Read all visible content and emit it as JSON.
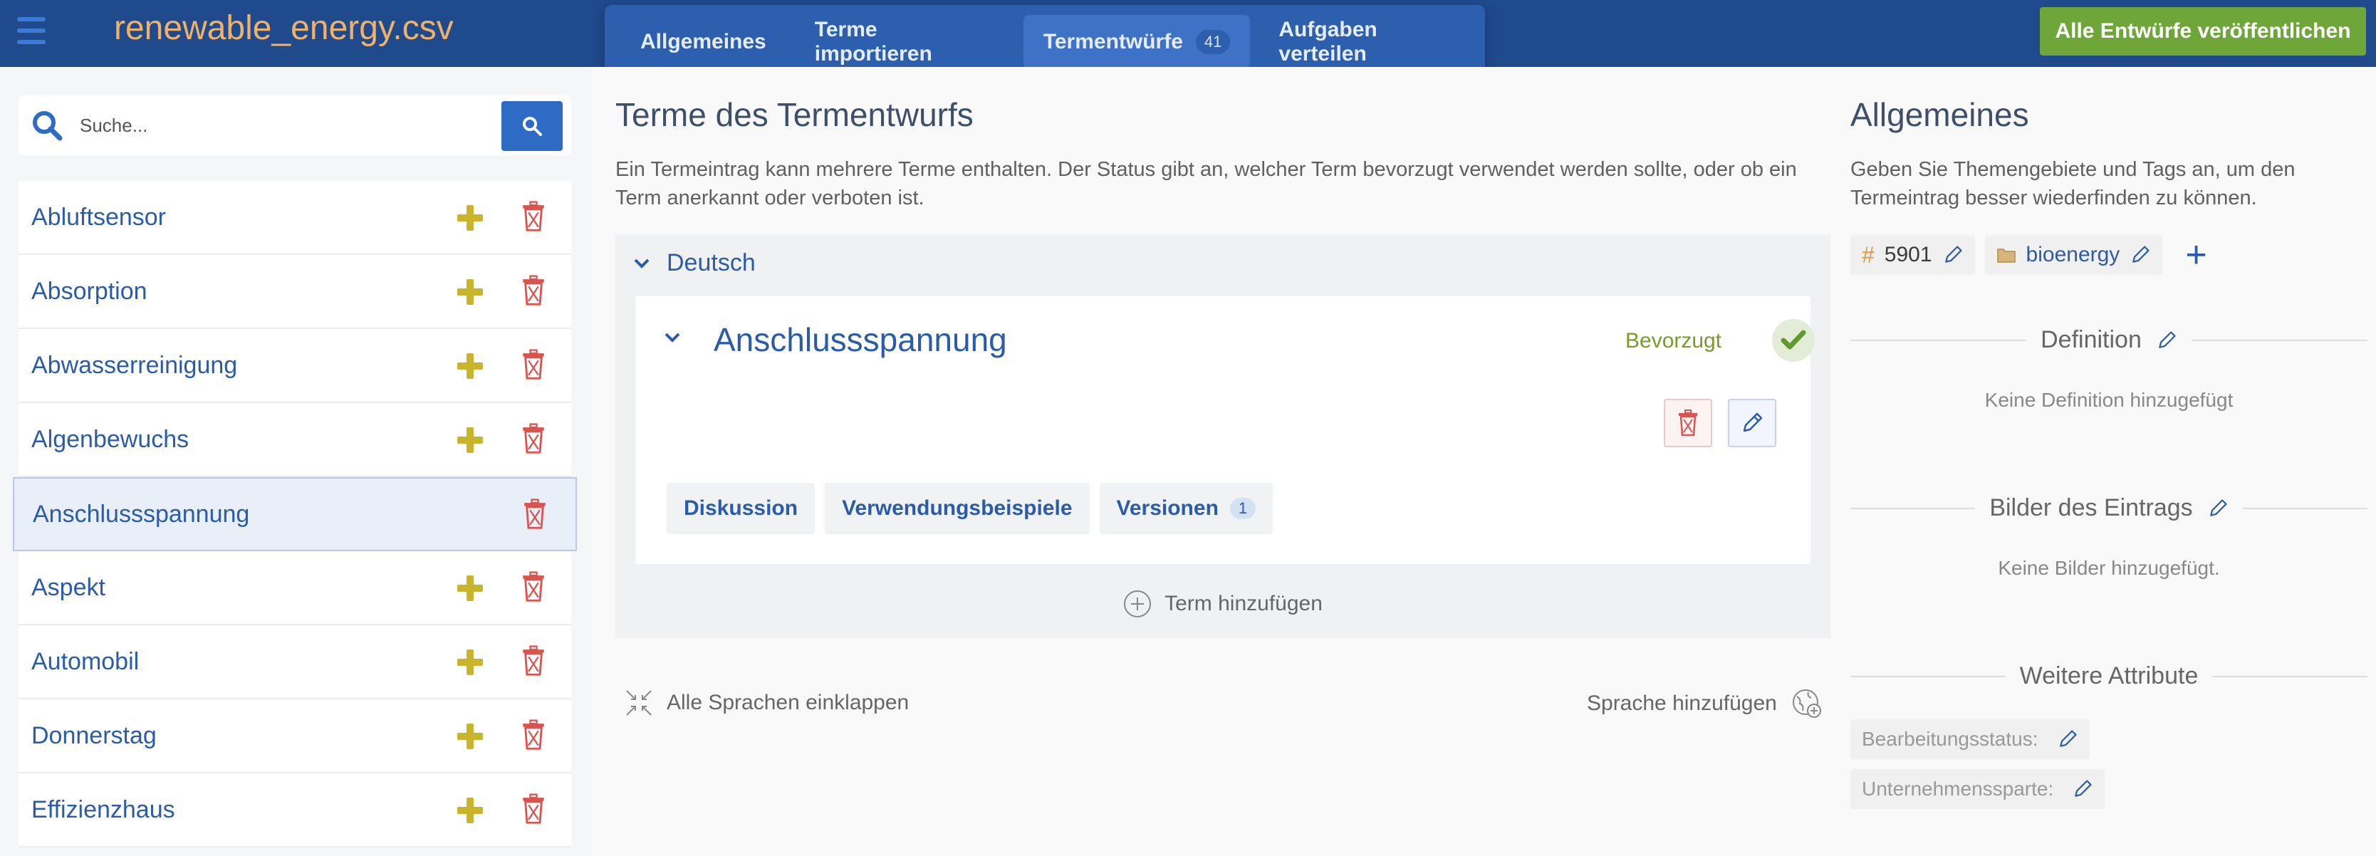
{
  "header": {
    "menu_icon": "hamburger-icon",
    "file_name": "renewable_energy.csv",
    "tabs": [
      {
        "label": "Allgemeines"
      },
      {
        "label": "Terme importieren"
      },
      {
        "label": "Termentwürfe",
        "count": "41"
      },
      {
        "label": "Aufgaben verteilen"
      }
    ],
    "active_tab": "Termentwürfe",
    "publish_button": "Alle Entwürfe veröffentlichen"
  },
  "sidebar": {
    "search_placeholder": "Suche...",
    "search_icon": "search-icon",
    "items": [
      {
        "label": "Abluftsensor"
      },
      {
        "label": "Absorption"
      },
      {
        "label": "Abwasserreinigung"
      },
      {
        "label": "Algenbewuchs"
      },
      {
        "label": "Anschlussspannung"
      },
      {
        "label": "Aspekt"
      },
      {
        "label": "Automobil"
      },
      {
        "label": "Donnerstag"
      },
      {
        "label": "Effizienzhaus"
      }
    ],
    "selected_item": "Anschlussspannung"
  },
  "main": {
    "title": "Terme des Termentwurfs",
    "description": "Ein Termeintrag kann mehrere Terme enthalten. Der Status gibt an, welcher Term bevorzugt verwendet werden sollte, oder ob ein Term anerkannt oder verboten ist.",
    "language": "Deutsch",
    "term": {
      "name": "Anschlussspannung",
      "status": "Bevorzugt",
      "tabs": [
        {
          "label": "Diskussion"
        },
        {
          "label": "Verwendungsbeispiele"
        },
        {
          "label": "Versionen",
          "count": "1"
        }
      ]
    },
    "add_term": "Term hinzufügen",
    "collapse_all": "Alle Sprachen einklappen",
    "add_language": "Sprache hinzufügen"
  },
  "right": {
    "title": "Allgemeines",
    "description": "Geben Sie Themengebiete und Tags an, um den Termeintrag besser wiederfinden zu können.",
    "tag_id": "5901",
    "topic": "bioenergy",
    "definition_title": "Definition",
    "definition_empty": "Keine Definition hinzugefügt",
    "images_title": "Bilder des Eintrags",
    "images_empty": "Keine Bilder hinzugefügt.",
    "attributes_title": "Weitere Attribute",
    "attributes": [
      {
        "label": "Bearbeitungsstatus:"
      },
      {
        "label": "Unternehmenssparte:"
      }
    ]
  },
  "colors": {
    "topbar": "#1f4a8c",
    "title_orange": "#f0b26a",
    "publish_green": "#6fa63a",
    "link_blue": "#2a5caa",
    "plus_yellow": "#c8b52c",
    "trash_red": "#d9534f"
  }
}
